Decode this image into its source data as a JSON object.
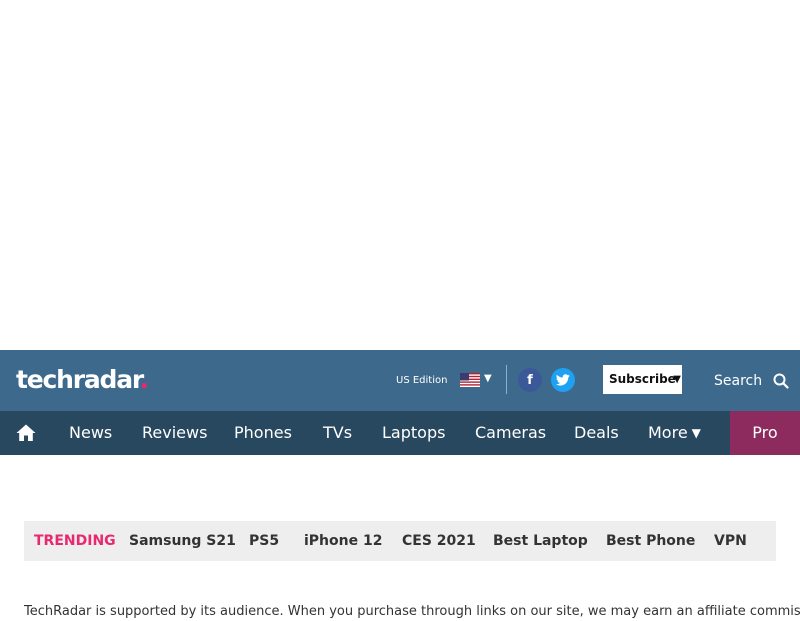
{
  "header": {
    "logo_main": "techradar",
    "logo_dot": ".",
    "edition_label": "US Edition",
    "flag_caret": "▼",
    "facebook_glyph": "f",
    "subscribe_label": "Subscribe",
    "subscribe_caret": "▼",
    "search_label": "Search"
  },
  "nav": {
    "items": [
      "News",
      "Reviews",
      "Phones",
      "TVs",
      "Laptops",
      "Cameras",
      "Deals",
      "More"
    ],
    "more_caret": "▼",
    "pro_label": "Pro"
  },
  "trending": {
    "label": "TRENDING",
    "items": [
      "Samsung S21",
      "PS5",
      "iPhone 12",
      "CES 2021",
      "Best Laptop",
      "Best Phone",
      "VPN"
    ]
  },
  "disclaimer": "TechRadar is supported by its audience. When you purchase through links on our site, we may earn an affiliate commission.",
  "colors": {
    "header_bg": "#3d6a8c",
    "nav_bg": "#28485f",
    "pro_bg": "#8d2a5e",
    "accent_pink": "#e9296d",
    "facebook": "#3b5998",
    "twitter": "#1da1f2"
  },
  "icons": {
    "home": "home-icon",
    "search": "search-icon",
    "facebook": "facebook-icon",
    "twitter": "twitter-icon",
    "flag": "us-flag-icon"
  }
}
